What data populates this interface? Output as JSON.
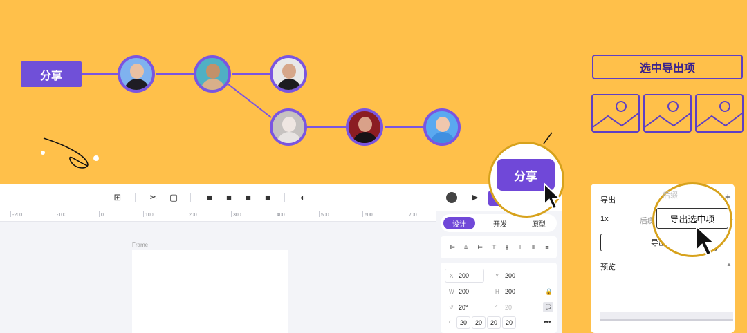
{
  "share": {
    "label": "分享"
  },
  "export_selected": {
    "label": "选中导出项"
  },
  "toolbar": {
    "icons": [
      "grid-icon",
      "scissors-icon",
      "crop-frame-icon",
      "layer-front-icon",
      "layer-forward-icon",
      "layer-backward-icon",
      "layer-back-icon",
      "contrast-icon",
      "user-avatar-icon",
      "play-icon"
    ]
  },
  "ruler": {
    "labels": [
      "-200",
      "-100",
      "0",
      "100",
      "200",
      "300",
      "400",
      "500",
      "600",
      "700"
    ]
  },
  "canvas": {
    "frame_label": "Frame"
  },
  "design_panel": {
    "tabs": [
      "设计",
      "开发",
      "原型"
    ],
    "x_label": "X",
    "x_value": "200",
    "y_label": "Y",
    "y_value": "200",
    "w_label": "W",
    "w_value": "200",
    "h_label": "H",
    "h_value": "200",
    "rotation_value": "20°",
    "radius_value": "20",
    "corner_values": [
      "20",
      "20",
      "20",
      "20"
    ]
  },
  "zoom_share": {
    "label": "分享"
  },
  "export_panel": {
    "title": "导出",
    "scale": "1x",
    "suffix_placeholder": "后缀",
    "suffix_header": "后缀",
    "export_button": "导出",
    "preview_label": "预览"
  },
  "zoom_export": {
    "label": "导出选中项"
  },
  "colors": {
    "accent": "#7048D8",
    "background": "#FFC04A",
    "outline": "#D7A21C"
  }
}
